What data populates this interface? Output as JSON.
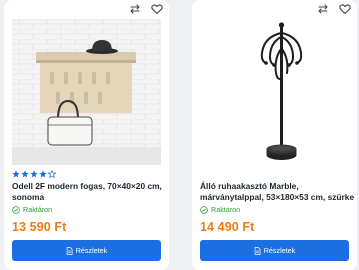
{
  "colors": {
    "accent": "#1c6fe0",
    "price": "#ef7d0b",
    "in_stock": "#2e9d3a",
    "star": "#1c6fe0"
  },
  "products": [
    {
      "title": "Odell 2F modern fogas, 70×40×20 cm, sonoma",
      "rating": {
        "value": 4,
        "max": 5
      },
      "stock": "Raktáron",
      "price": "13 590 Ft",
      "button": "Részletek",
      "icons": [
        "compare-icon",
        "heart-icon"
      ]
    },
    {
      "title": "Álló ruhaakasztó Marble, márványtalppal, 53×180×53 cm, szürke",
      "stock": "Raktáron",
      "price": "14 490 Ft",
      "button": "Részletek",
      "icons": [
        "compare-icon",
        "heart-icon"
      ]
    }
  ]
}
